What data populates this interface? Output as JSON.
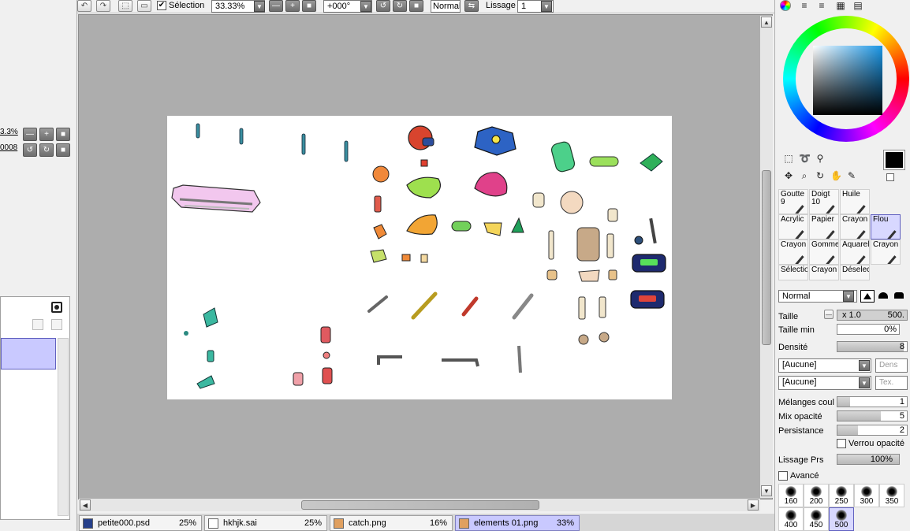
{
  "toolbar": {
    "selection_label": "Sélection",
    "selection_checked": true,
    "zoom": "33.33%",
    "rotation": "+000°",
    "blend_mode": "Normal",
    "smoothing_label": "Lissage",
    "smoothing_value": "1"
  },
  "navigator": {
    "zoom_partial": "3.3%",
    "rotation_partial": "0008"
  },
  "tabs": [
    {
      "name": "petite000.psd",
      "zoom": "25%",
      "active": false
    },
    {
      "name": "hkhjk.sai",
      "zoom": "25%",
      "active": false
    },
    {
      "name": "catch.png",
      "zoom": "16%",
      "active": false
    },
    {
      "name": "elements 01.png",
      "zoom": "33%",
      "active": true
    }
  ],
  "tools": [
    {
      "name": "Goutte",
      "sub": "9",
      "selected": false
    },
    {
      "name": "Doigt",
      "sub": "10",
      "selected": false
    },
    {
      "name": "Huile",
      "sub": "",
      "selected": false
    },
    {
      "name": "Acrylic",
      "sub": "",
      "selected": false
    },
    {
      "name": "Papier",
      "sub": "",
      "selected": false
    },
    {
      "name": "Crayon",
      "sub": "",
      "selected": false
    },
    {
      "name": "Flou",
      "sub": "",
      "selected": true
    },
    {
      "name": "Crayon",
      "sub": "",
      "selected": false
    },
    {
      "name": "Gomme",
      "sub": "",
      "selected": false
    },
    {
      "name": "Aquarell",
      "sub": "",
      "selected": false
    },
    {
      "name": "Crayon",
      "sub": "",
      "selected": false
    },
    {
      "name": "Sélection",
      "sub": "",
      "selected": false
    },
    {
      "name": "Crayon",
      "sub": "",
      "selected": false
    },
    {
      "name": "Déselect",
      "sub": "",
      "selected": false
    }
  ],
  "brush": {
    "mode": "Normal",
    "taille_label": "Taille",
    "taille_mult": "x 1.0",
    "taille_value": "500.",
    "taille_min_label": "Taille min",
    "taille_min_value": "0%",
    "densite_label": "Densité",
    "densite_value": "8",
    "texture1": "[Aucune]",
    "texture1_side": "Dens",
    "texture2": "[Aucune]",
    "texture2_side": "Tex.",
    "melanges_label": "Mélanges coul",
    "melanges_value": "1",
    "mix_label": "Mix opacité",
    "mix_value": "5",
    "persistance_label": "Persistance",
    "persistance_value": "2",
    "verrou_label": "Verrou opacité",
    "lissage_prs_label": "Lissage Prs",
    "lissage_prs_value": "100%",
    "avance_label": "Avancé"
  },
  "brush_sizes": [
    "160",
    "200",
    "250",
    "300",
    "350",
    "400",
    "450",
    "500"
  ],
  "colors": {
    "primary": "#000000",
    "secondary": "#ffffff",
    "accent_selected": "#c9c9ff",
    "workspace": "#adadad"
  }
}
